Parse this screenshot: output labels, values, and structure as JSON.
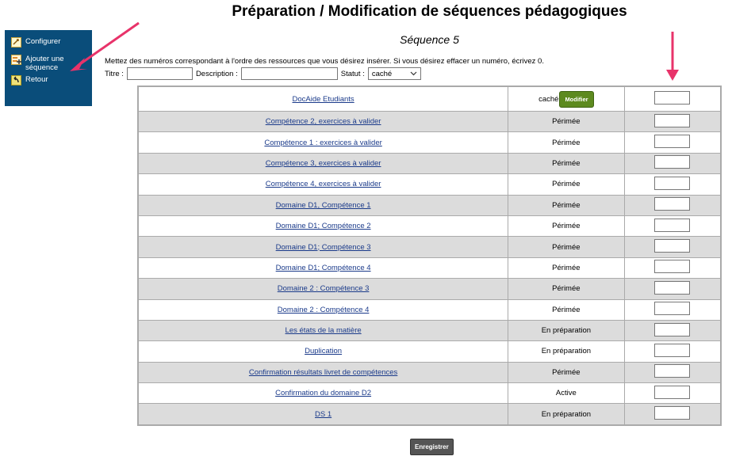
{
  "header": {
    "title": "Préparation / Modification de séquences pédagogiques",
    "sequence": "Séquence 5"
  },
  "sidebar": {
    "items": [
      {
        "label": "Configurer",
        "icon": "configure-icon"
      },
      {
        "label": "Ajouter une séquence",
        "icon": "add-sequence-icon"
      },
      {
        "label": "Retour",
        "icon": "back-icon"
      }
    ]
  },
  "instructions": "Mettez des numéros correspondant à l'ordre des ressources que vous désirez insérer. Si vous désirez effacer un numéro, écrivez 0.",
  "filters": {
    "title_label": "Titre :",
    "title_value": "",
    "description_label": "Description :",
    "description_value": "",
    "status_label": "Statut :",
    "status_value": "caché"
  },
  "rows": [
    {
      "title": "DocAide Etudiants",
      "status": "caché",
      "action": "Modifier",
      "order": ""
    },
    {
      "title": "Compétence 2, exercices à valider",
      "status": "Périmée",
      "order": ""
    },
    {
      "title": "Compétence 1 : exercices à valider",
      "status": "Périmée",
      "order": ""
    },
    {
      "title": "Compétence 3, exercices à valider",
      "status": "Périmée",
      "order": ""
    },
    {
      "title": "Compétence 4, exercices à valider",
      "status": "Périmée",
      "order": ""
    },
    {
      "title": "Domaine D1, Compétence 1",
      "status": "Périmée",
      "order": ""
    },
    {
      "title": "Domaine D1; Compétence 2",
      "status": "Périmée",
      "order": ""
    },
    {
      "title": "Domaine D1; Compétence 3",
      "status": "Périmée",
      "order": ""
    },
    {
      "title": "Domaine D1; Compétence 4",
      "status": "Périmée",
      "order": ""
    },
    {
      "title": "Domaine 2 : Compétence 3",
      "status": "Périmée",
      "order": ""
    },
    {
      "title": "Domaine 2 : Compétence 4",
      "status": "Périmée",
      "order": ""
    },
    {
      "title": "Les états de la matière",
      "status": "En préparation",
      "order": ""
    },
    {
      "title": "Duplication",
      "status": "En préparation",
      "order": ""
    },
    {
      "title": "Confirmation résultats livret de compétences",
      "status": "Périmée",
      "order": ""
    },
    {
      "title": "Confirmation du domaine D2",
      "status": "Active",
      "order": ""
    },
    {
      "title": "DS 1",
      "status": "En préparation",
      "order": ""
    }
  ],
  "save_label": "Enregistrer",
  "colors": {
    "sidebar_bg": "#0a4d7a",
    "row_alt_bg": "#dcdcdc",
    "link": "#1a3a8a",
    "modify_button": "#5d8a1f",
    "annotation_arrow": "#e8336a"
  }
}
